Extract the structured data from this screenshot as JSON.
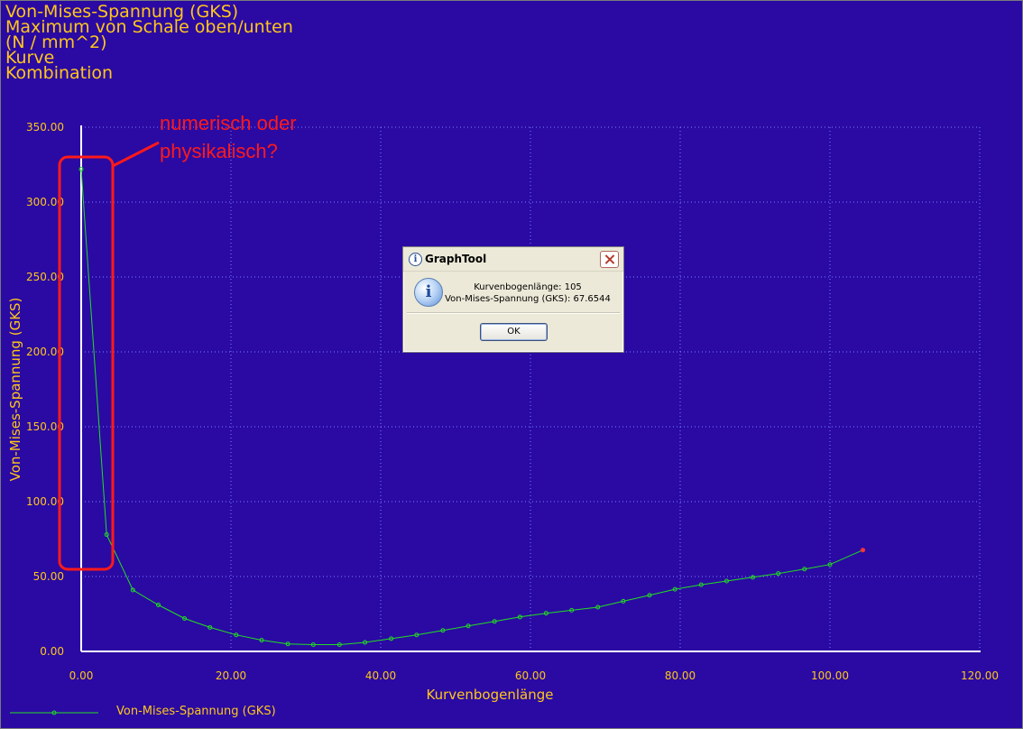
{
  "header": {
    "lines": [
      "Von-Mises-Spannung (GKS)",
      "Maximum von Schale oben/unten",
      "(N / mm^2)",
      "Kurve",
      "Kombination"
    ]
  },
  "annotation": {
    "line1": "numerisch oder",
    "line2": "physikalisch?",
    "color": "#ff1a1a"
  },
  "colors": {
    "background": "#2a0aa3",
    "axis_text": "#ffc61a",
    "series": "#22dd22",
    "grid": "#8080ff",
    "endpoint": "#ff3333"
  },
  "chart_data": {
    "type": "line",
    "title": "",
    "xlabel": "Kurvenbogenlänge",
    "ylabel": "Von-Mises-Spannung (GKS)",
    "xlim": [
      0,
      120
    ],
    "ylim": [
      0,
      350
    ],
    "xticks": [
      "0.00",
      "20.00",
      "40.00",
      "60.00",
      "80.00",
      "100.00",
      "120.00"
    ],
    "yticks": [
      "0.00",
      "50.00",
      "100.00",
      "150.00",
      "200.00",
      "250.00",
      "300.00",
      "350.00"
    ],
    "grid": true,
    "legend": "bottom-left",
    "series": [
      {
        "name": "Von-Mises-Spannung (GKS)",
        "x": [
          0,
          3.4,
          6.9,
          10.3,
          13.8,
          17.2,
          20.7,
          24.1,
          27.6,
          31.0,
          34.5,
          37.9,
          41.4,
          44.8,
          48.3,
          51.7,
          55.2,
          58.6,
          62.1,
          65.5,
          69.0,
          72.4,
          75.9,
          79.3,
          82.8,
          86.2,
          89.7,
          93.1,
          96.6,
          100.0,
          104.4
        ],
        "y": [
          322,
          78,
          41,
          31,
          22,
          16,
          11,
          7.5,
          5,
          4.5,
          4.5,
          6,
          8.5,
          11,
          14,
          17,
          20,
          23,
          25.5,
          27.5,
          29.5,
          33.5,
          37.5,
          41.5,
          44.5,
          47,
          49.5,
          52,
          55,
          58,
          67.6544
        ]
      }
    ]
  },
  "dialog": {
    "title": "GraphTool",
    "message_line1": "Kurvenbogenlänge: 105",
    "message_line2": "Von-Mises-Spannung (GKS): 67.6544",
    "ok_label": "OK"
  }
}
